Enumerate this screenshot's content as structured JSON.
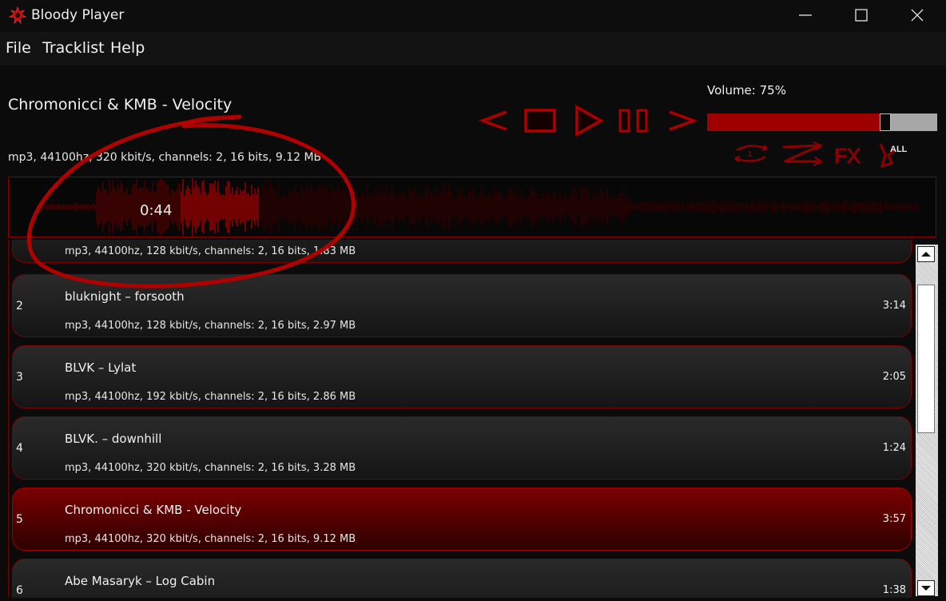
{
  "app": {
    "title": "Bloody Player"
  },
  "menu": {
    "items": [
      "File",
      "Tracklist",
      "Help"
    ]
  },
  "now_playing": {
    "title": "Chromonicci & KMB - Velocity",
    "info": "mp3, 44100hz, 320 kbit/s, channels: 2, 16 bits, 9.12 MB",
    "position_label": "0:44"
  },
  "volume": {
    "label": "Volume: 75%",
    "level": 0.75
  },
  "mode_icons": {
    "fx_label": "FX",
    "repeat_label": "ALL",
    "repeat_one_label": "1"
  },
  "controls": [
    "previous",
    "stop",
    "play",
    "pause",
    "next"
  ],
  "colors": {
    "accent": "#9e0000",
    "active_row": "#7a0000",
    "background": "#0b0b0b"
  },
  "playlist": [
    {
      "num": "",
      "name": "",
      "info": "mp3, 44100hz, 128 kbit/s, channels: 2, 16 bits, 1.83 MB",
      "duration": ""
    },
    {
      "num": "2",
      "name": "bluknight  – forsooth",
      "info": "mp3, 44100hz, 128 kbit/s, channels: 2, 16 bits, 2.97 MB",
      "duration": "3:14"
    },
    {
      "num": "3",
      "name": "BLVK – Lylat",
      "info": "mp3, 44100hz, 192 kbit/s, channels: 2, 16 bits, 2.86 MB",
      "duration": "2:05"
    },
    {
      "num": "4",
      "name": "BLVK. – downhill",
      "info": "mp3, 44100hz, 320 kbit/s, channels: 2, 16 bits, 3.28 MB",
      "duration": "1:24"
    },
    {
      "num": "5",
      "name": "Chromonicci & KMB - Velocity",
      "info": "mp3, 44100hz, 320 kbit/s, channels: 2, 16 bits, 9.12 MB",
      "duration": "3:57"
    },
    {
      "num": "6",
      "name": "Abe Masaryk – Log Cabin",
      "info": "",
      "duration": "1:38"
    }
  ]
}
